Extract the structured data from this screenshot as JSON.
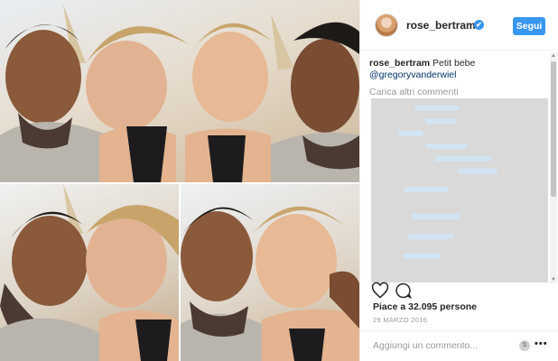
{
  "post": {
    "username": "rose_bertram",
    "verified_icon": "✔",
    "follow_label": "Segui",
    "caption_user": "rose_bertram",
    "caption_text": "Petit bebe",
    "mention": "@gregoryvanderwiel",
    "load_more": "Carica altri commenti",
    "likes": "Piace a 32.095 persone",
    "date": "29 MARZO 2016",
    "add_comment_placeholder": "Aggiungi un commento...",
    "more_label": "•••",
    "sort_label": "⇅"
  },
  "icons": {
    "like": "heart-icon",
    "comment": "comment-icon",
    "verified": "verified-badge-icon",
    "more": "more-options-icon"
  },
  "colors": {
    "accent": "#3897f0",
    "text": "#262626",
    "muted": "#999999",
    "mention": "#003569",
    "overlay": "#d9d9d9"
  }
}
